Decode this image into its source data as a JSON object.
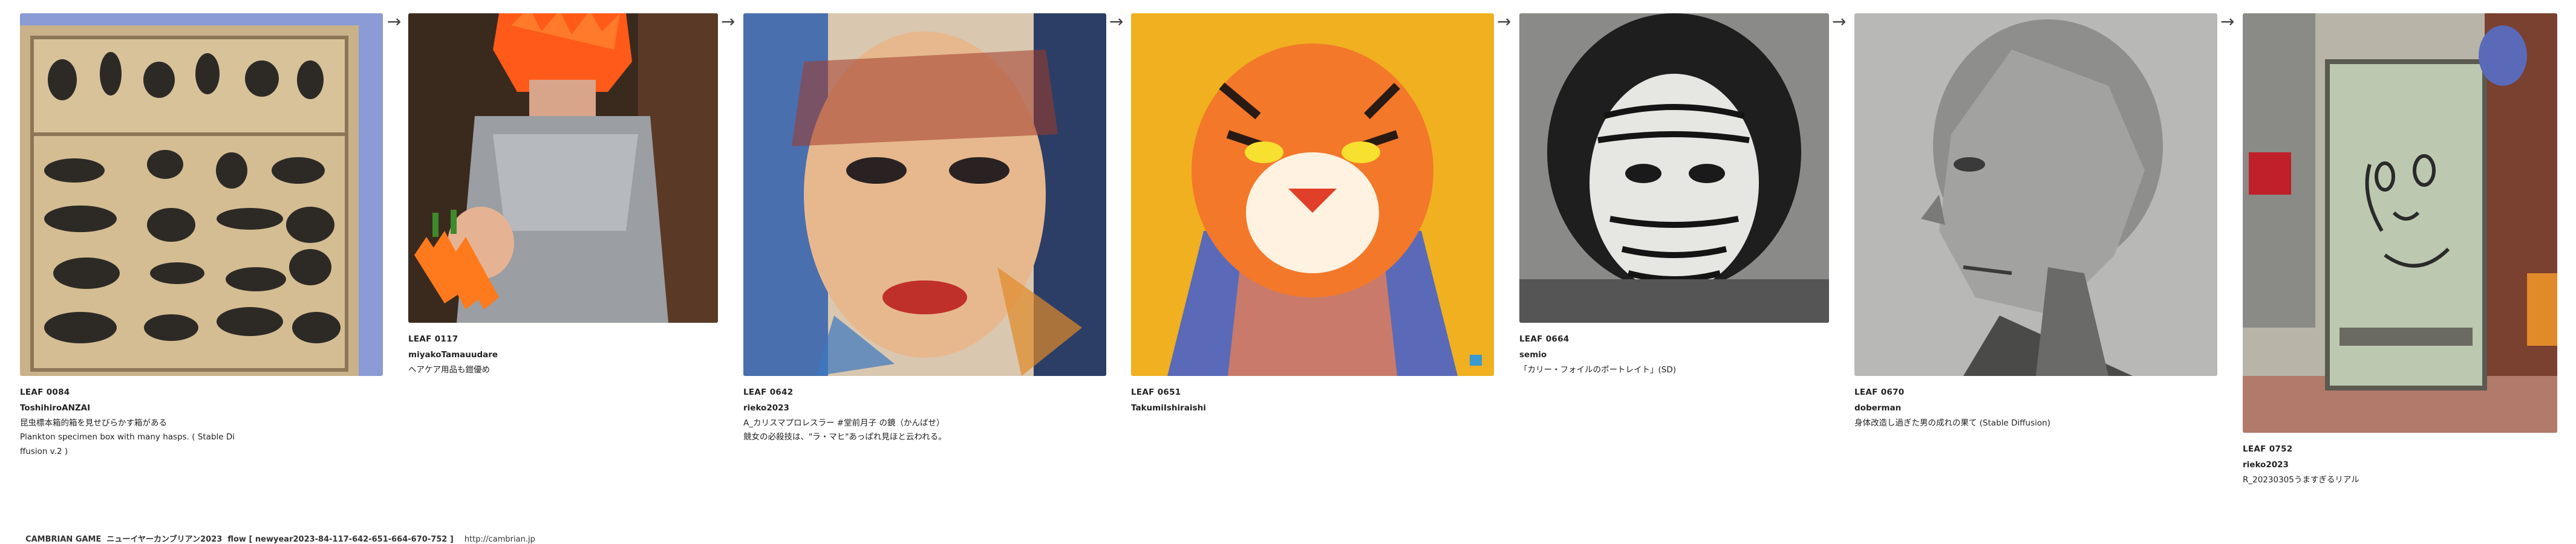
{
  "arrow_glyph": "→",
  "leaves": [
    {
      "id": "LEAF 0084",
      "author": "ToshihiroANZAI",
      "caption": "昆虫標本箱的箱を見せびらかす箱がある\nPlankton specimen box with many hasps. ( Stable Di\nffusion v.2 )",
      "image": "box-of-specimens"
    },
    {
      "id": "LEAF 0117",
      "author": "miyakoTamauudare",
      "caption": "ヘアケア用品も鎧優め",
      "image": "orange-hair-armor"
    },
    {
      "id": "LEAF 0642",
      "author": "rieko2023",
      "caption": "A_カリスマプロレスラー #堂前月子 の鏡（かんばせ）\n競女の必殺技は、\"ラ・マヒ\"あっぱれ見ほと云われる。",
      "image": "painted-face"
    },
    {
      "id": "LEAF 0651",
      "author": "TakumiIshiraishi",
      "caption": "",
      "image": "tiger-portrait"
    },
    {
      "id": "LEAF 0664",
      "author": "semio",
      "caption": "「カリー・フォイルのポートレイト」(SD)",
      "image": "zebra-face"
    },
    {
      "id": "LEAF 0670",
      "author": "doberman",
      "caption": "身体改造し過ぎた男の成れの果て (Stable Diffusion)",
      "image": "bald-man"
    },
    {
      "id": "LEAF 0752",
      "author": "rieko2023",
      "caption": "R_20230305うますぎるリアル",
      "image": "street-sign-face"
    }
  ],
  "footer": {
    "text": "CAMBRIAN GAME  ニューイヤーカンブリアン2023  flow [ newyear2023-84-117-642-651-664-670-752 ]",
    "url": "http://cambrian.jp"
  }
}
